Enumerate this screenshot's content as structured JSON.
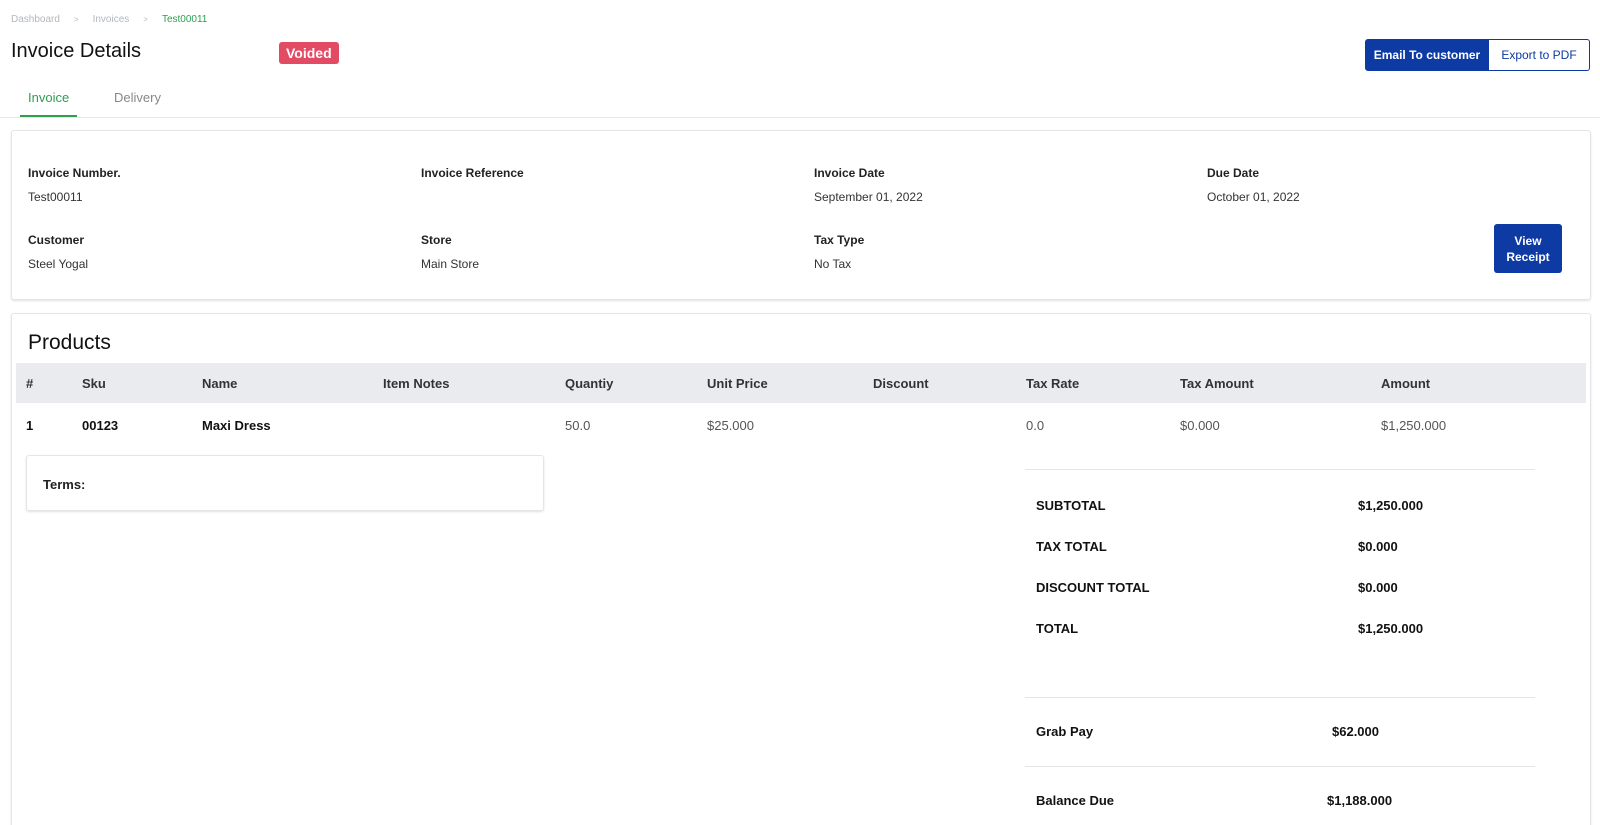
{
  "breadcrumb": {
    "items": [
      "Dashboard",
      "Invoices",
      "Test00011"
    ],
    "separator": ">"
  },
  "header": {
    "title": "Invoice Details",
    "status_badge": "Voided",
    "email_button": "Email To customer",
    "export_button": "Export to PDF"
  },
  "tabs": [
    {
      "label": "Invoice",
      "active": true
    },
    {
      "label": "Delivery",
      "active": false
    }
  ],
  "invoice": {
    "number_label": "Invoice Number.",
    "number_value": "Test00011",
    "reference_label": "Invoice Reference",
    "reference_value": "",
    "date_label": "Invoice Date",
    "date_value": "September 01, 2022",
    "due_label": "Due Date",
    "due_value": "October 01, 2022",
    "customer_label": "Customer",
    "customer_value": "Steel Yogal",
    "store_label": "Store",
    "store_value": "Main Store",
    "taxtype_label": "Tax Type",
    "taxtype_value": "No Tax",
    "view_receipt_button": "View Receipt"
  },
  "products": {
    "title": "Products",
    "columns": [
      "#",
      "Sku",
      "Name",
      "Item Notes",
      "Quantiy",
      "Unit Price",
      "Discount",
      "Tax Rate",
      "Tax Amount",
      "Amount"
    ],
    "rows": [
      [
        "1",
        "00123",
        "Maxi Dress",
        "",
        "50.0",
        "$25.000",
        "",
        "0.0",
        "$0.000",
        "$1,250.000"
      ]
    ]
  },
  "terms": {
    "label": "Terms:"
  },
  "totals": {
    "subtotal_label": "SUBTOTAL",
    "subtotal_value": "$1,250.000",
    "tax_label": "TAX TOTAL",
    "tax_value": "$0.000",
    "discount_label": "DISCOUNT TOTAL",
    "discount_value": "$0.000",
    "total_label": "TOTAL",
    "total_value": "$1,250.000",
    "payment_label": "Grab Pay",
    "payment_value": "$62.000",
    "balance_label": "Balance Due",
    "balance_value": "$1,188.000"
  },
  "colors": {
    "primary": "#0d3aa3",
    "accent_green": "#2e9e4f",
    "voided_badge": "#e34a63",
    "table_header_bg": "#e9ebee"
  }
}
